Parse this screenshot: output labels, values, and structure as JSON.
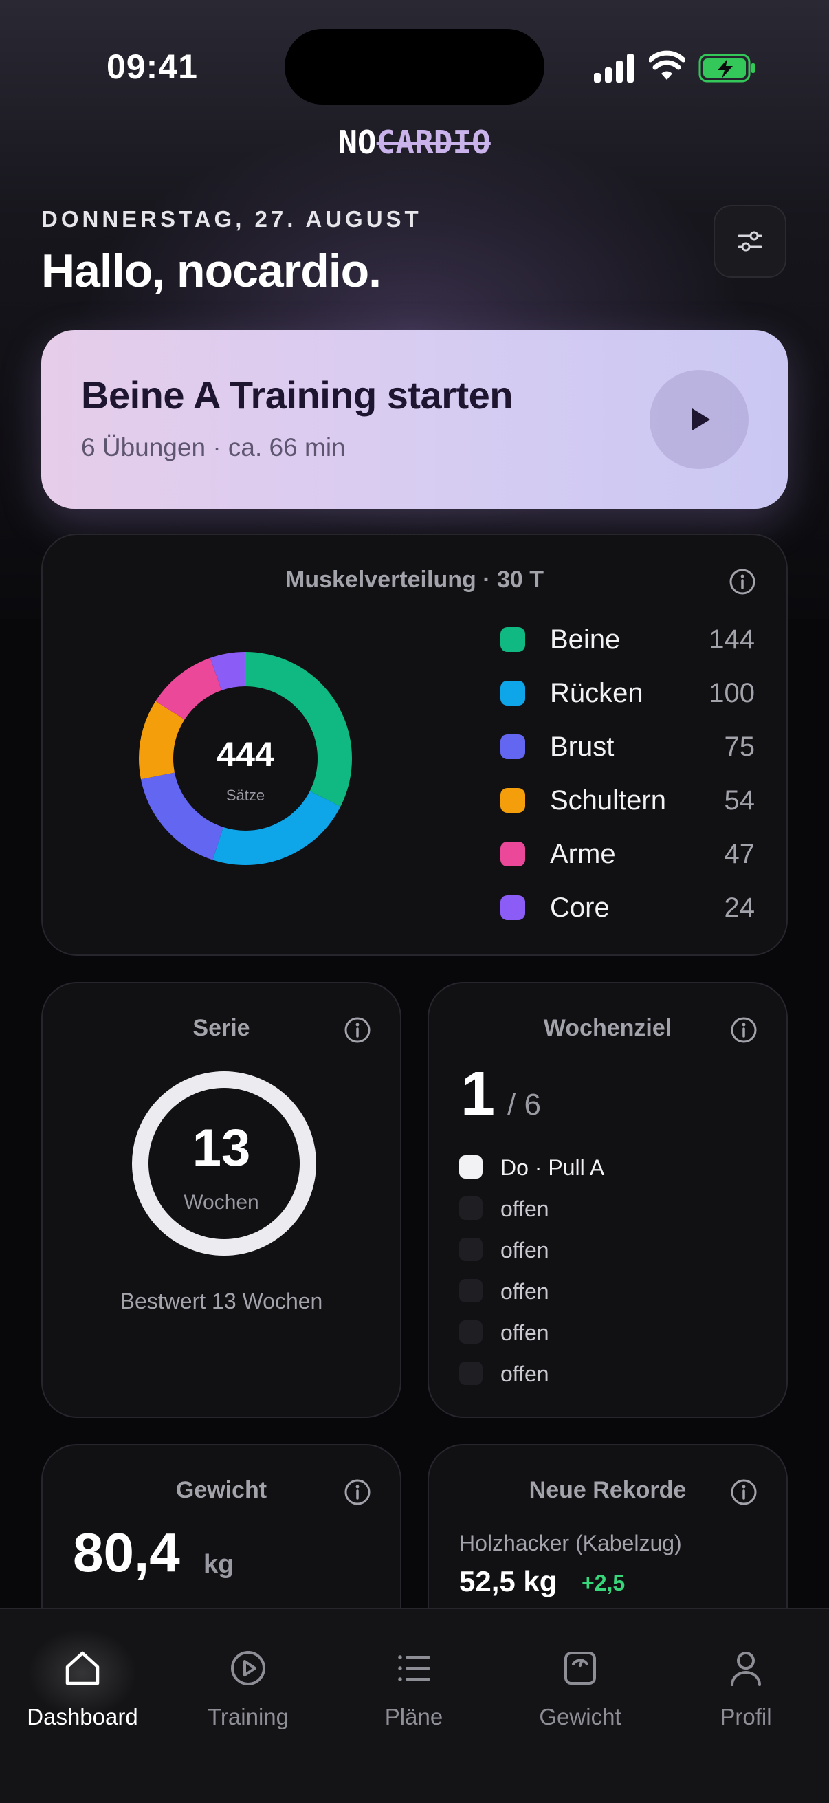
{
  "status_bar": {
    "time": "09:41"
  },
  "logo": {
    "prefix": "NO",
    "struck": "CARDIO"
  },
  "header": {
    "date": "DONNERSTAG, 27. AUGUST",
    "greeting": "Hallo, nocardio."
  },
  "start_card": {
    "title": "Beine A Training starten",
    "subtitle": "6 Übungen · ca. 66 min"
  },
  "muscle_card": {
    "title": "Muskelverteilung · 30 T",
    "total": "444",
    "total_label": "Sätze",
    "items": [
      {
        "name": "Beine",
        "value": "144",
        "color": "#10b981"
      },
      {
        "name": "Rücken",
        "value": "100",
        "color": "#0ea5e9"
      },
      {
        "name": "Brust",
        "value": "75",
        "color": "#6366f1"
      },
      {
        "name": "Schultern",
        "value": "54",
        "color": "#f59e0b"
      },
      {
        "name": "Arme",
        "value": "47",
        "color": "#ec4899"
      },
      {
        "name": "Core",
        "value": "24",
        "color": "#8b5cf6"
      }
    ]
  },
  "series_card": {
    "title": "Serie",
    "value": "13",
    "unit": "Wochen",
    "best": "Bestwert 13 Wochen"
  },
  "goal_card": {
    "title": "Wochenziel",
    "done": "1",
    "total": "/ 6",
    "items": [
      {
        "label": "Do · Pull A",
        "done": true
      },
      {
        "label": "offen",
        "done": false
      },
      {
        "label": "offen",
        "done": false
      },
      {
        "label": "offen",
        "done": false
      },
      {
        "label": "offen",
        "done": false
      },
      {
        "label": "offen",
        "done": false
      }
    ]
  },
  "weight_card": {
    "title": "Gewicht",
    "value": "80,4",
    "unit": "kg"
  },
  "records_card": {
    "title": "Neue Rekorde",
    "exercise": "Holzhacker (Kabelzug)",
    "value": "52,5 kg",
    "delta": "+2,5"
  },
  "tabbar": {
    "items": [
      {
        "label": "Dashboard",
        "icon": "home-icon",
        "active": true
      },
      {
        "label": "Training",
        "icon": "play-circle-icon",
        "active": false
      },
      {
        "label": "Pläne",
        "icon": "list-icon",
        "active": false
      },
      {
        "label": "Gewicht",
        "icon": "scale-icon",
        "active": false
      },
      {
        "label": "Profil",
        "icon": "person-icon",
        "active": false
      }
    ]
  }
}
